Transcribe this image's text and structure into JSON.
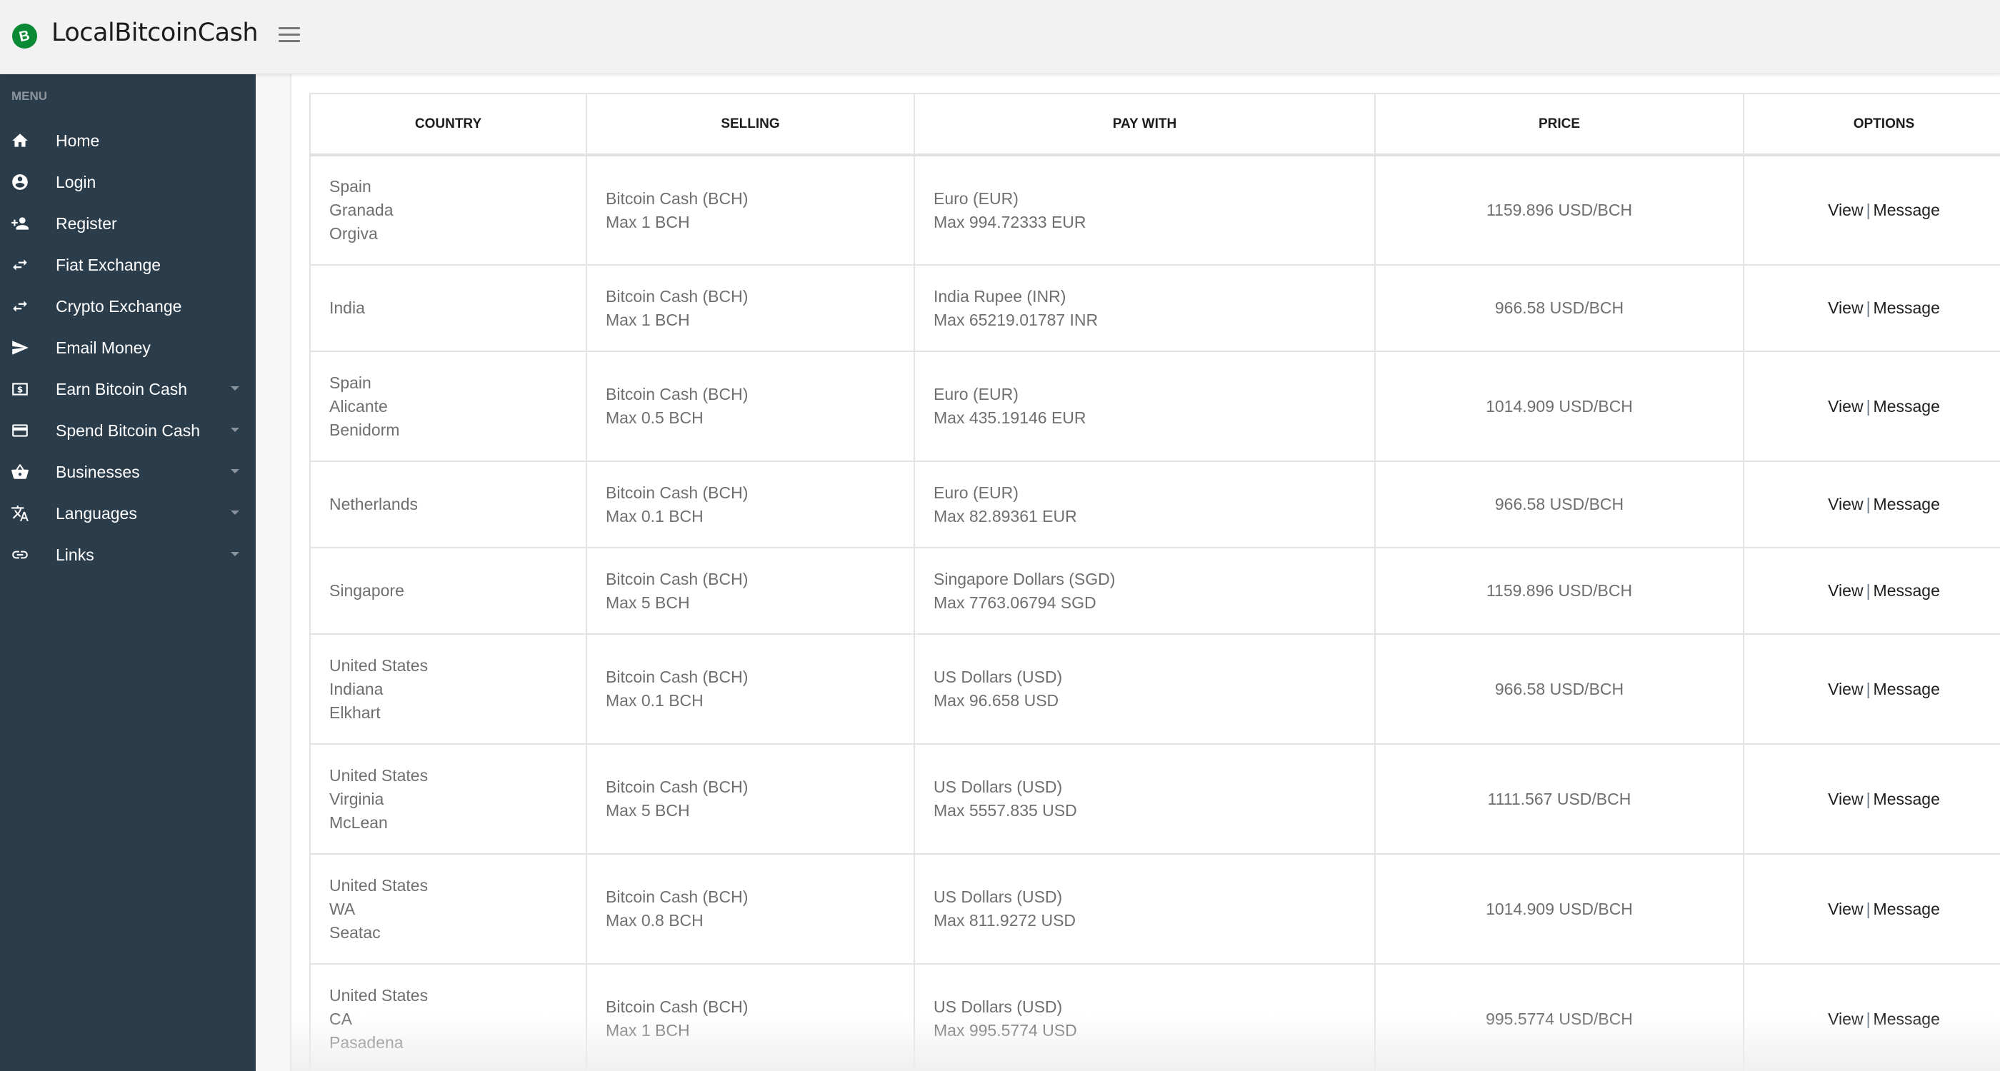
{
  "header": {
    "brand": "LocalBitcoinCash",
    "logo_icon": "bitcoin-cash-logo-icon",
    "logo_glyph": "B",
    "menu_icon": "hamburger-menu-icon"
  },
  "sidebar": {
    "menu_label": "MENU",
    "items": [
      {
        "label": "Home",
        "icon": "home-icon",
        "has_submenu": false
      },
      {
        "label": "Login",
        "icon": "account-circle-icon",
        "has_submenu": false
      },
      {
        "label": "Register",
        "icon": "person-add-icon",
        "has_submenu": false
      },
      {
        "label": "Fiat Exchange",
        "icon": "swap-arrows-icon",
        "has_submenu": false
      },
      {
        "label": "Crypto Exchange",
        "icon": "swap-arrows-icon",
        "has_submenu": false
      },
      {
        "label": "Email Money",
        "icon": "send-icon",
        "has_submenu": false
      },
      {
        "label": "Earn Bitcoin Cash",
        "icon": "money-icon",
        "has_submenu": true
      },
      {
        "label": "Spend Bitcoin Cash",
        "icon": "credit-card-icon",
        "has_submenu": true
      },
      {
        "label": "Businesses",
        "icon": "shopping-basket-icon",
        "has_submenu": true
      },
      {
        "label": "Languages",
        "icon": "translate-icon",
        "has_submenu": true
      },
      {
        "label": "Links",
        "icon": "link-icon",
        "has_submenu": true
      }
    ]
  },
  "table": {
    "columns": [
      "COUNTRY",
      "SELLING",
      "PAY WITH",
      "PRICE",
      "OPTIONS"
    ],
    "option_labels": {
      "view": "View",
      "separator": "|",
      "message": "Message"
    },
    "rows": [
      {
        "location": [
          "Spain",
          "Granada",
          "Orgiva"
        ],
        "selling": [
          "Bitcoin Cash (BCH)",
          "Max 1 BCH"
        ],
        "pay_with": [
          "Euro (EUR)",
          "Max 994.72333 EUR"
        ],
        "price": "1159.896 USD/BCH"
      },
      {
        "location": [
          "India"
        ],
        "selling": [
          "Bitcoin Cash (BCH)",
          "Max 1 BCH"
        ],
        "pay_with": [
          "India Rupee (INR)",
          "Max 65219.01787 INR"
        ],
        "price": "966.58 USD/BCH"
      },
      {
        "location": [
          "Spain",
          "Alicante",
          "Benidorm"
        ],
        "selling": [
          "Bitcoin Cash (BCH)",
          "Max 0.5 BCH"
        ],
        "pay_with": [
          "Euro (EUR)",
          "Max 435.19146 EUR"
        ],
        "price": "1014.909 USD/BCH"
      },
      {
        "location": [
          "Netherlands"
        ],
        "selling": [
          "Bitcoin Cash (BCH)",
          "Max 0.1 BCH"
        ],
        "pay_with": [
          "Euro (EUR)",
          "Max 82.89361 EUR"
        ],
        "price": "966.58 USD/BCH"
      },
      {
        "location": [
          "Singapore"
        ],
        "selling": [
          "Bitcoin Cash (BCH)",
          "Max 5 BCH"
        ],
        "pay_with": [
          "Singapore Dollars (SGD)",
          "Max 7763.06794 SGD"
        ],
        "price": "1159.896 USD/BCH"
      },
      {
        "location": [
          "United States",
          "Indiana",
          "Elkhart"
        ],
        "selling": [
          "Bitcoin Cash (BCH)",
          "Max 0.1 BCH"
        ],
        "pay_with": [
          "US Dollars (USD)",
          "Max 96.658 USD"
        ],
        "price": "966.58 USD/BCH"
      },
      {
        "location": [
          "United States",
          "Virginia",
          "McLean"
        ],
        "selling": [
          "Bitcoin Cash (BCH)",
          "Max 5 BCH"
        ],
        "pay_with": [
          "US Dollars (USD)",
          "Max 5557.835 USD"
        ],
        "price": "1111.567 USD/BCH"
      },
      {
        "location": [
          "United States",
          "WA",
          "Seatac"
        ],
        "selling": [
          "Bitcoin Cash (BCH)",
          "Max 0.8 BCH"
        ],
        "pay_with": [
          "US Dollars (USD)",
          "Max 811.9272 USD"
        ],
        "price": "1014.909 USD/BCH"
      },
      {
        "location": [
          "United States",
          "CA",
          "Pasadena"
        ],
        "selling": [
          "Bitcoin Cash (BCH)",
          "Max 1 BCH"
        ],
        "pay_with": [
          "US Dollars (USD)",
          "Max 995.5774 USD"
        ],
        "price": "995.5774 USD/BCH"
      }
    ]
  },
  "colors": {
    "sidebar_bg": "#2b3c4b",
    "header_bg": "#f2f2f2",
    "logo_green": "#0b8a36",
    "cell_text": "#6f6f6f",
    "link_text": "#1e1e1e"
  }
}
